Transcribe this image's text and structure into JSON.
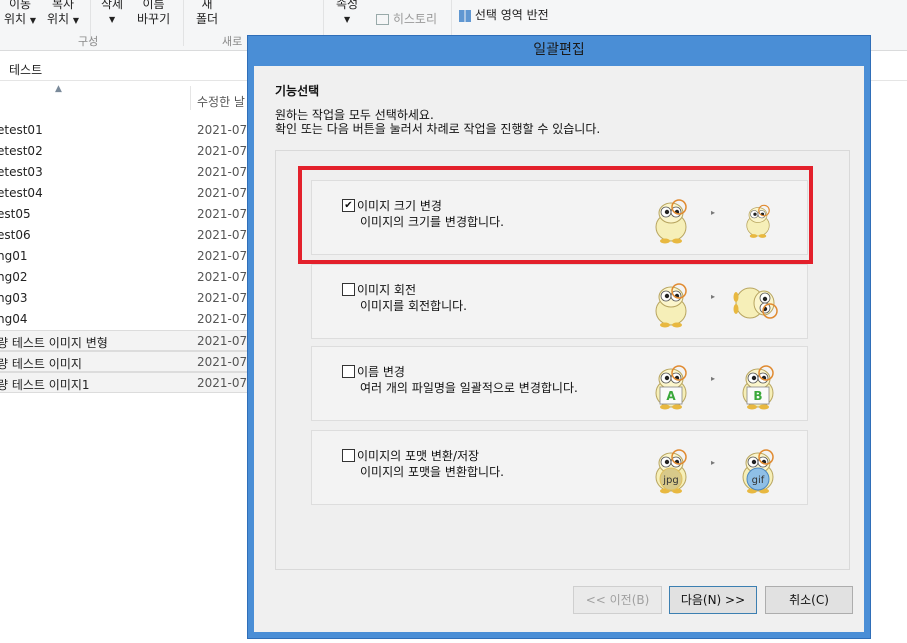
{
  "ribbon": {
    "move_line1": "이동",
    "move_line2": "위치",
    "copy_line1": "복사",
    "copy_line2": "위치",
    "delete_label": "삭제",
    "rename_line1": "이름",
    "rename_line2": "바꾸기",
    "new_line1": "새",
    "new_line2": "폴더",
    "properties_label": "속성",
    "history_label": "히스토리",
    "invert_selection_label": "선택 영역 반전",
    "group_organize": "구성",
    "group_new": "새로"
  },
  "path": {
    "current": "테스트"
  },
  "columns": {
    "modified": "수정한 날"
  },
  "files": [
    {
      "name": "etest01",
      "date": "2021-07-"
    },
    {
      "name": "etest02",
      "date": "2021-07-"
    },
    {
      "name": "etest03",
      "date": "2021-07-"
    },
    {
      "name": "etest04",
      "date": "2021-07-"
    },
    {
      "name": "est05",
      "date": "2021-07-"
    },
    {
      "name": "est06",
      "date": "2021-07-"
    },
    {
      "name": "ng01",
      "date": "2021-07-"
    },
    {
      "name": "ng02",
      "date": "2021-07-"
    },
    {
      "name": "ng03",
      "date": "2021-07-"
    },
    {
      "name": "ng04",
      "date": "2021-07-"
    },
    {
      "name": "량 테스트 이미지 변형",
      "date": "2021-07-",
      "selected": true
    },
    {
      "name": "량 테스트 이미지",
      "date": "2021-07-",
      "selected": true
    },
    {
      "name": "량 테스트 이미지1",
      "date": "2021-07-",
      "selected": true
    }
  ],
  "dialog": {
    "title": "일괄편집",
    "section_title": "기능선택",
    "instruction_1": "원하는 작업을 모두 선택하세요.",
    "instruction_2": "확인 또는 다음 버튼을 눌러서 차례로 작업을 진행할 수 있습니다.",
    "options": [
      {
        "title": "이미지 크기 변경",
        "desc": "이미지의 크기를 변경합니다.",
        "checked": true,
        "check_glyph": "✔",
        "icon_before": "mascot-icon",
        "icon_after": "small-mascot-icon"
      },
      {
        "title": "이미지 회전",
        "desc": "이미지를 회전합니다.",
        "checked": false,
        "check_glyph": "",
        "icon_before": "mascot-icon",
        "icon_after": "rotated-mascot-icon"
      },
      {
        "title": "이름 변경",
        "desc": "여러 개의 파일명을 일괄적으로 변경합니다.",
        "checked": false,
        "check_glyph": "",
        "icon_before": "mascot-sign-a-icon",
        "icon_after": "mascot-sign-b-icon",
        "sign_before": "A",
        "sign_after": "B"
      },
      {
        "title": "이미지의 포맷 변환/저장",
        "desc": "이미지의 포맷을 변환합니다.",
        "checked": false,
        "check_glyph": "",
        "icon_before": "mascot-jpg-icon",
        "icon_after": "mascot-gif-icon",
        "sign_before": "jpg",
        "sign_after": "gif"
      }
    ],
    "arrow_glyph": "▸",
    "buttons": {
      "prev": "<< 이전(B)",
      "next": "다음(N) >>",
      "cancel": "취소(C)"
    },
    "highlight_color": "#e3202b",
    "title_bar_color": "#4a8ed6"
  }
}
